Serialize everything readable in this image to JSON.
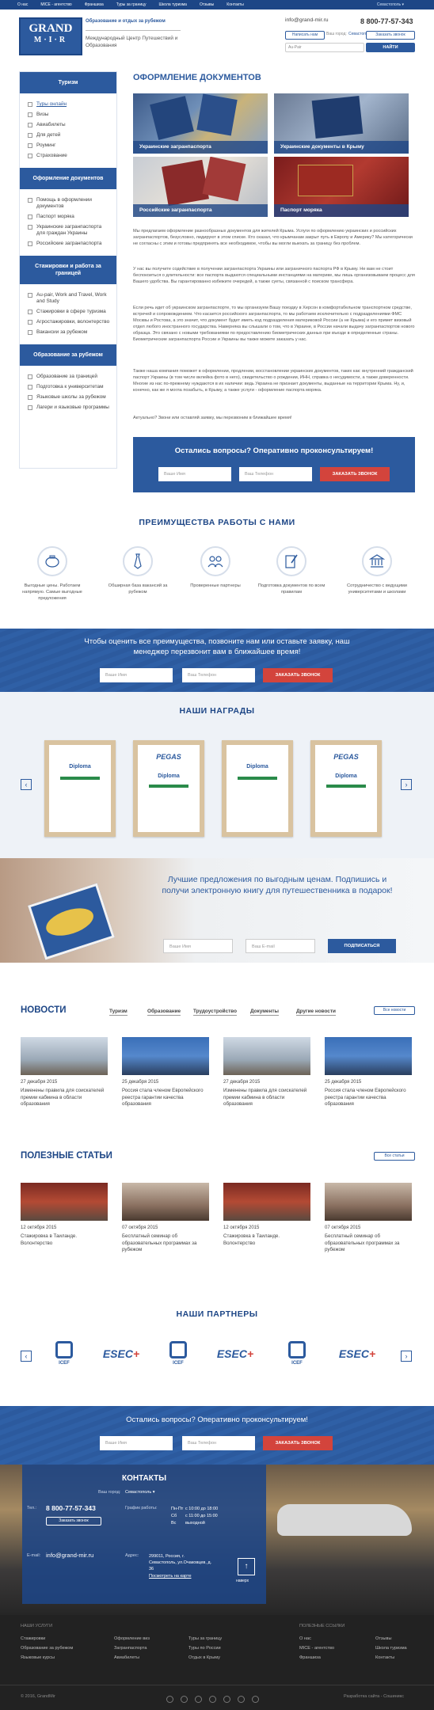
{
  "topnav": {
    "items": [
      "О нас",
      "MICE - агентство",
      "Франшиза",
      "Туры за границу",
      "Школа туризма",
      "Отзывы",
      "Контакты"
    ],
    "city": "Севастополь ▾"
  },
  "header": {
    "logo_top": "GRAND",
    "logo_bottom": "M·I·R",
    "tagline1": "Образование и отдых за рубежом",
    "tagline2": "Международный Центр Путешествий и Образования",
    "email": "info@grand-mir.ru",
    "city_label": "Ваш город:",
    "city": "Севастополь ▾",
    "phone": "8 800-77-57-343",
    "write_btn": "Написать нам",
    "call_btn": "Заказать звонок",
    "search_label": "Au-Pair",
    "search_btn": "НАЙТИ"
  },
  "sidebar": [
    {
      "title": "Туризм",
      "items": [
        "Туры онлайн",
        "Визы",
        "Авиабилеты",
        "Для детей",
        "Роуминг",
        "Страхование"
      ]
    },
    {
      "title": "Оформление документов",
      "items": [
        "Помощь в оформлении документов",
        "Паспорт моряка",
        "Украинские загранпаспорта для граждан Украины",
        "Российские загранпаспорта"
      ]
    },
    {
      "title": "Стажировки и работа за границей",
      "items": [
        "Au-pair, Work and Travel, Work and Study",
        "Стажировки в сфере туризма",
        "Агростажировки, волонтерство",
        "Вакансии за рубежом"
      ]
    },
    {
      "title": "Образование за рубежом",
      "items": [
        "Образование за границей",
        "Подготовка к университетам",
        "Языковые школы за рубежом",
        "Лагери и языковые программы"
      ]
    }
  ],
  "main": {
    "title": "ОФОРМЛЕНИЕ ДОКУМЕНТОВ",
    "tiles": [
      "Украинские загранпаспорта",
      "Украинские документы в Крыму",
      "Российские загранпаспорта",
      "Паспорт моряка"
    ],
    "paragraphs": [
      "Мы предлагаем оформление разнообразных документов для жителей Крыма. Услуги по оформлению украинских и российских загранпаспортов, безусловно, лидируют в этом списке. Кто сказал, что крымчанам закрыт путь в Европу и Америку? Мы категорически не согласны с этим и готовы предпринять все необходимое, чтобы вы могли выехать за границу без проблем.",
      "У нас вы получите содействие в получении загранпаспорта Украины или заграничного паспорта РФ в Крыму. Не вам не стоит беспокоиться о длительности: все паспорта выдаются специальными инстанциями на материке, мы лишь организовываем процесс для Вашего удобства. Вы гарантированно избежите очередей, а также суеты, связанной с поиском трансфера.",
      "Если речь идет об украинском загранпаспорте, то мы организуем Вашу поездку в Херсон в комфортабельном транспортном средстве, встречей и сопровождением. Что касается российского загранпаспорта, то мы работаем исключительно с подразделениями ФМС Москвы и Ростова, а это значит, что документ будет иметь код подразделения материковой России (а не Крыма) и его примет визовый отдел любого иностранного государства. Наверняка вы слышали о том, что в Украине, в России начали выдачу загранпаспортов нового образца. Это связано с новыми требованиями по предоставлению биометрических данных при въезде в определенные страны. Биометрические загранпаспорта России и Украины вы также можете заказать у нас.",
      "Также наша компания поможет в оформлении, продлении, восстановлении украинских документов, таких как: внутренний гражданский паспорт Украины (в том числе вклейка фото в него), свидетельство о рождении, ИНН, справка о несудимости, а также доверенности. Многие из нас по-прежнему нуждаются в их наличии: ведь Украина не признает документы, выданные на территории Крыма. Ну, и, конечно, как же я могла позабыть, в Крыму, а также услуги - оформление паспорта моряка.",
      "Актуально? Звони или оставляй заявку, мы перезвоним в ближайшее время!"
    ]
  },
  "cta1": {
    "title": "Остались вопросы? Оперативно проконсультируем!",
    "name_ph": "Ваше Имя",
    "phone_ph": "Ваш Телефон",
    "btn": "ЗАКАЗАТЬ ЗВОНОК"
  },
  "advantages": {
    "title": "ПРЕИМУЩЕСТВА РАБОТЫ С НАМИ",
    "items": [
      "Выгодные цены. Работаем напрямую. Самые выгодные предложения",
      "Обширная база вакансий за рубежом",
      "Проверенные партнеры",
      "Подготовка документов по всем правилам",
      "Сотрудничество с ведущими университетами и школами"
    ]
  },
  "cta2": {
    "title": "Чтобы оценить все преимущества, позвоните нам или оставьте заявку, наш менеджер перезвонит вам в ближайшее время!",
    "name_ph": "Ваше Имя",
    "phone_ph": "Ваш Телефон",
    "btn": "ЗАКАЗАТЬ ЗВОНОК"
  },
  "awards": {
    "title": "НАШИ НАГРАДЫ",
    "labels": [
      "Diploma",
      "PEGAS",
      "Diploma",
      "PEGAS"
    ]
  },
  "subscribe": {
    "title": "Лучшие предложения по выгодным ценам. Подпишись и получи электронную книгу для путешественника в подарок!",
    "name_ph": "Ваше Имя",
    "email_ph": "Ваш E-mail",
    "btn": "ПОДПИСАТЬСЯ"
  },
  "news": {
    "title": "НОВОСТИ",
    "tabs": [
      "Туризм",
      "Образование",
      "Трудоустройство",
      "Документы",
      "Другие новости"
    ],
    "all": "Все новости",
    "items": [
      {
        "date": "27 декабря 2015",
        "text": "Изменены правила для соискателей премии кабмина в области образования"
      },
      {
        "date": "25 декабря 2015",
        "text": "Россия стала членом Европейского реестра гарантии качества образования"
      },
      {
        "date": "27 декабря 2015",
        "text": "Изменены правила для соискателей премии кабмина в области образования"
      },
      {
        "date": "25 декабря 2015",
        "text": "Россия стала членом Европейского реестра гарантии качества образования"
      }
    ]
  },
  "articles": {
    "title": "ПОЛЕЗНЫЕ СТАТЬИ",
    "all": "Все статьи",
    "items": [
      {
        "date": "12 октября 2015",
        "text": "Стажировка в Таиланде. Волонтерство"
      },
      {
        "date": "07 октября 2015",
        "text": "Бесплатный семинар об образовательных программах за рубежом"
      },
      {
        "date": "12 октября 2015",
        "text": "Стажировка в Таиланде. Волонтерство"
      },
      {
        "date": "07 октября 2015",
        "text": "Бесплатный семинар об образовательных программах за рубежом"
      }
    ]
  },
  "partners": {
    "title": "НАШИ ПАРТНЕРЫ",
    "logos": [
      "ICEF",
      "ESEC",
      "ICEF",
      "ESEC",
      "ICEF",
      "ESEC"
    ]
  },
  "cta3": {
    "title": "Остались вопросы? Оперативно проконсультируем!",
    "name_ph": "Ваше Имя",
    "phone_ph": "Ваш Телефон",
    "btn": "ЗАКАЗАТЬ ЗВОНОК"
  },
  "contacts": {
    "title": "КОНТАКТЫ",
    "city_label": "Ваш город:",
    "city": "Севастополь ▾",
    "tel_label": "Тел.:",
    "phone": "8 800-77-57-343",
    "call_btn": "Заказать звонок",
    "schedule_label": "График работы:",
    "schedule": [
      [
        "Пн-Пт",
        "с 10:00 до 18:00"
      ],
      [
        "Сб",
        "с 11:00 до 15:00"
      ],
      [
        "Вс",
        "выходной"
      ]
    ],
    "email_label": "E-mail:",
    "email": "info@grand-mir.ru",
    "address_label": "Адрес:",
    "address": "299011, Россия, г. Севастополь, ул.Очаковцев, д. 36",
    "map_link": "Посмотреть на карте",
    "up": "наверх"
  },
  "footer": {
    "services_title": "НАШИ УСЛУГИ",
    "col1": [
      "Стажировки",
      "Образование за рубежом",
      "Языковые курсы"
    ],
    "col2": [
      "Оформление виз",
      "Загранпаспорта",
      "Авиабилеты"
    ],
    "col3": [
      "Туры за границу",
      "Туры по России",
      "Отдых в Крыму"
    ],
    "links_title": "ПОЛЕЗНЫЕ ССЫЛКИ",
    "col4": [
      "О нас",
      "MICE - агентство",
      "Франшиза"
    ],
    "col5": [
      "Отзывы",
      "Школа туризма",
      "Контакты"
    ],
    "copyright": "© 2016, GrandMir",
    "dev": "Разработка сайта - Сошиникс"
  },
  "colors": {
    "brand": "#2c5a9e",
    "dark": "#1d4686",
    "accent": "#d3443c",
    "footer": "#222222"
  }
}
